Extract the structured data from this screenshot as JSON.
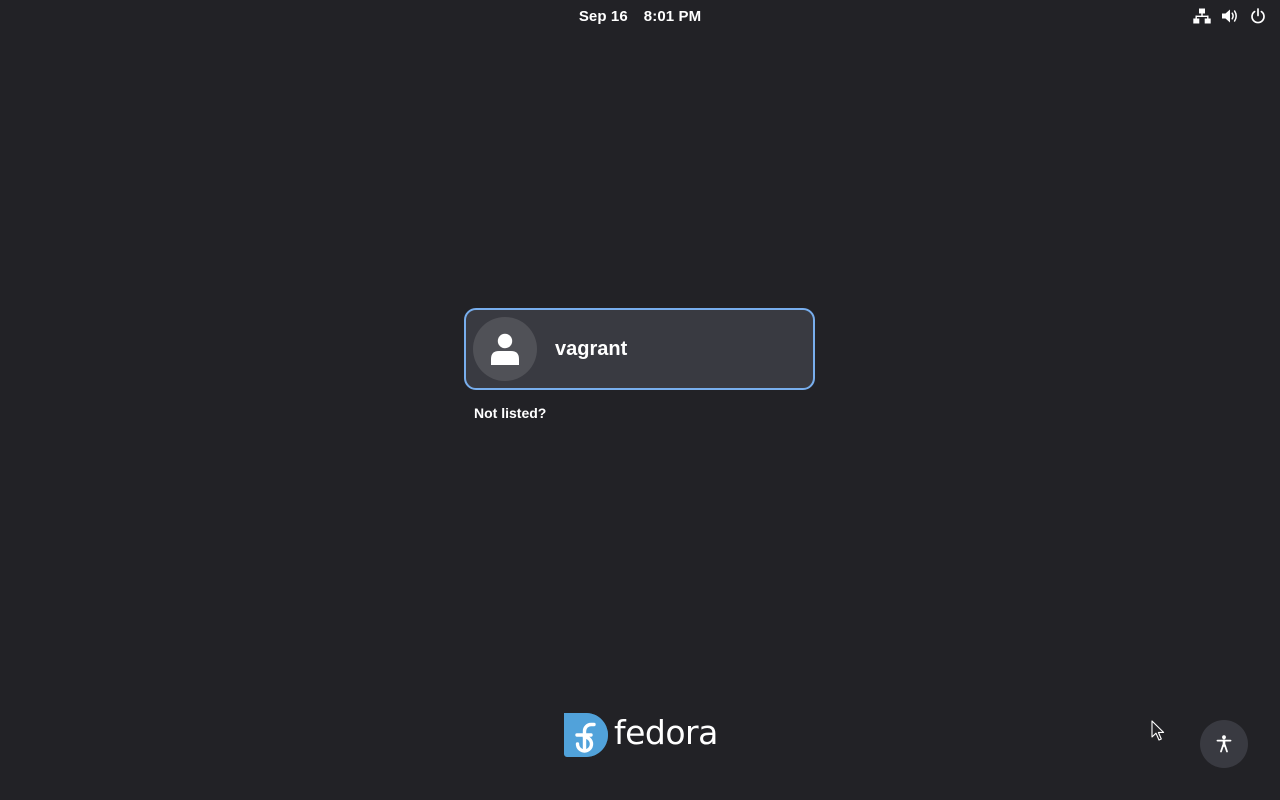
{
  "top_bar": {
    "date": "Sep 16",
    "time": "8:01 PM",
    "status_icons": [
      "network-wired-icon",
      "volume-icon",
      "power-icon"
    ]
  },
  "user_list": {
    "users": [
      {
        "name": "vagrant",
        "avatar_icon": "user-avatar-icon"
      }
    ],
    "not_listed_label": "Not listed?"
  },
  "branding": {
    "logo_text": "fedora",
    "logo_icon": "fedora-logo-icon"
  },
  "accessibility": {
    "icon": "accessibility-icon"
  },
  "colors": {
    "background": "#222226",
    "card": "#393a41",
    "card_border": "#78aeed",
    "avatar_bg": "#505157",
    "fedora_blue": "#51a2da",
    "text": "#ffffff"
  }
}
